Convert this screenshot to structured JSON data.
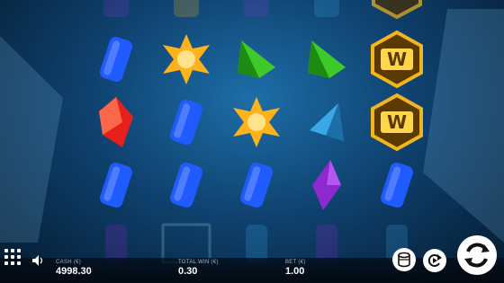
{
  "wallet": {
    "cash_label": "CASH (€)",
    "cash_value": "4998.30",
    "win_label": "TOTAL WIN (€)",
    "win_value": "0.30",
    "bet_label": "BET (€)",
    "bet_value": "1.00"
  },
  "wild_symbol_text": "W",
  "colors": {
    "blue_gem": "#1f5bff",
    "orange_star": "#ffb21a",
    "green_gem": "#3ecb2a",
    "red_gem": "#e8201b",
    "cyan_gem": "#3aa7e8",
    "purple_gem": "#8c2ad0",
    "wild_gold": "#f2b51d",
    "wild_bg": "#5a3a00"
  },
  "grid": [
    [
      "blue-gem",
      "orange-star",
      "green-gem",
      "green-gem",
      "wild"
    ],
    [
      "red-gem",
      "blue-gem",
      "orange-star",
      "cyan-gem",
      "wild"
    ],
    [
      "blue-gem",
      "blue-gem",
      "blue-gem",
      "purple-gem",
      "blue-gem"
    ]
  ]
}
